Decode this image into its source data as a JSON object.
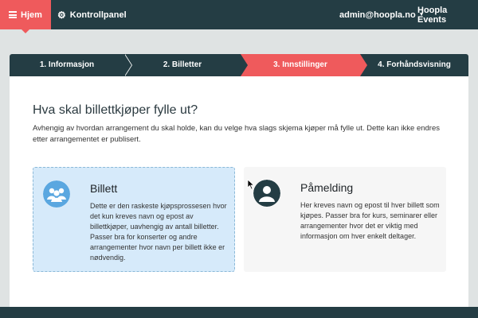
{
  "navbar": {
    "home_label": "Hjem",
    "control_panel_label": "Kontrollpanel",
    "user_email": "admin@hoopla.no",
    "brand": "Hoopla Events"
  },
  "steps": [
    {
      "label": "1. Informasjon",
      "active": false
    },
    {
      "label": "2. Billetter",
      "active": false
    },
    {
      "label": "3. Innstillinger",
      "active": true
    },
    {
      "label": "4. Forhåndsvisning",
      "active": false
    }
  ],
  "main": {
    "title": "Hva skal billettkjøper fylle ut?",
    "description": "Avhengig av hvordan arrangement du skal holde, kan du velge hva slags skjema kjøper må fylle ut. Dette kan ikke endres etter arrangementet er publisert."
  },
  "options": [
    {
      "title": "Billett",
      "text": "Dette er den raskeste kjøpsprossesen hvor det kun kreves navn og epost av billettkjøper, uavhengig av antall billetter. Passer bra for konserter og andre arrangementer hvor navn per billett ikke er nødvendig.",
      "icon": "group-icon",
      "selected": true
    },
    {
      "title": "Påmelding",
      "text": "Her kreves navn og epost til hver billett som kjøpes. Passer bra for kurs, seminarer eller arrangementer hvor det er viktig med informasjon om hver enkelt deltager.",
      "icon": "person-icon",
      "selected": false
    }
  ],
  "colors": {
    "accent": "#ef5a5c",
    "dark": "#243d44",
    "selected_bg": "#d6eafa",
    "icon_blue": "#5aa7e0"
  }
}
